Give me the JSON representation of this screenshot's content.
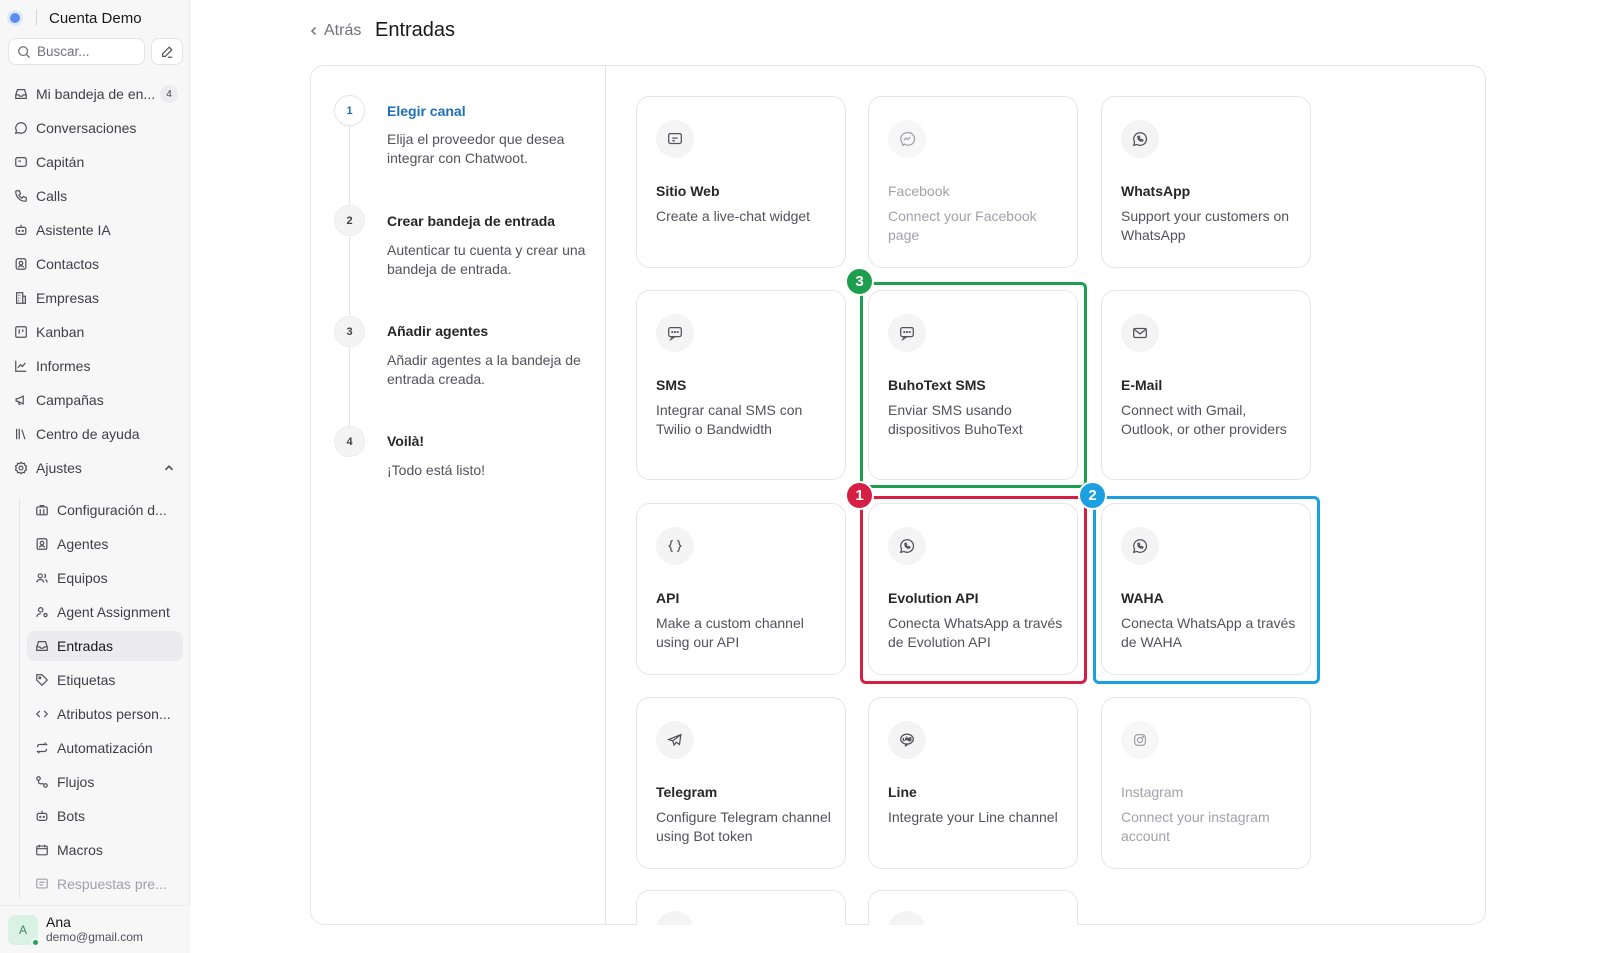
{
  "colors": {
    "accent": "#1d6fb8",
    "highlight_green": "#1e9e4f",
    "highlight_red": "#d61f45",
    "highlight_blue": "#1a9fe0"
  },
  "sidebar": {
    "account_name": "Cuenta Demo",
    "search_placeholder": "Buscar...",
    "items": [
      {
        "label": "Mi bandeja de en...",
        "icon": "inbox-icon",
        "badge": "4"
      },
      {
        "label": "Conversaciones",
        "icon": "chat-bubble-icon"
      },
      {
        "label": "Capitán",
        "icon": "captain-icon"
      },
      {
        "label": "Calls",
        "icon": "phone-icon"
      },
      {
        "label": "Asistente IA",
        "icon": "bot-icon"
      },
      {
        "label": "Contactos",
        "icon": "contact-card-icon"
      },
      {
        "label": "Empresas",
        "icon": "building-icon"
      },
      {
        "label": "Kanban",
        "icon": "kanban-icon"
      },
      {
        "label": "Informes",
        "icon": "chart-line-icon"
      },
      {
        "label": "Campañas",
        "icon": "megaphone-icon"
      },
      {
        "label": "Centro de ayuda",
        "icon": "library-icon"
      },
      {
        "label": "Ajustes",
        "icon": "settings-gear-icon"
      }
    ],
    "settings_items": [
      {
        "label": "Configuración d...",
        "icon": "briefcase-icon"
      },
      {
        "label": "Agentes",
        "icon": "agent-card-icon"
      },
      {
        "label": "Equipos",
        "icon": "users-icon"
      },
      {
        "label": "Agent Assignment",
        "icon": "user-assign-icon"
      },
      {
        "label": "Entradas",
        "icon": "inbox-icon"
      },
      {
        "label": "Etiquetas",
        "icon": "tag-icon"
      },
      {
        "label": "Atributos person...",
        "icon": "code-icon"
      },
      {
        "label": "Automatización",
        "icon": "repeat-icon"
      },
      {
        "label": "Flujos",
        "icon": "flow-icon"
      },
      {
        "label": "Bots",
        "icon": "bot-icon"
      },
      {
        "label": "Macros",
        "icon": "calendar-icon"
      },
      {
        "label": "Respuestas pre...",
        "icon": "canned-response-icon"
      }
    ],
    "user": {
      "initial": "A",
      "name": "Ana",
      "email": "demo@gmail.com"
    }
  },
  "header": {
    "back_label": "Atrás",
    "title": "Entradas"
  },
  "steps": [
    {
      "num": "1",
      "title": "Elegir canal",
      "desc": "Elija el proveedor que desea integrar con Chatwoot."
    },
    {
      "num": "2",
      "title": "Crear bandeja de entrada",
      "desc": "Autenticar tu cuenta y crear una bandeja de entrada."
    },
    {
      "num": "3",
      "title": "Añadir agentes",
      "desc": "Añadir agentes a la bandeja de entrada creada."
    },
    {
      "num": "4",
      "title": "Voilà!",
      "desc": "¡Todo está listo!"
    }
  ],
  "channels": [
    {
      "title": "Sitio Web",
      "desc": "Create a live-chat widget",
      "icon": "website-widget-icon"
    },
    {
      "title": "Facebook",
      "desc": "Connect your Facebook page",
      "icon": "messenger-icon"
    },
    {
      "title": "WhatsApp",
      "desc": "Support your customers on WhatsApp",
      "icon": "whatsapp-icon"
    },
    {
      "title": "SMS",
      "desc": "Integrar canal SMS con Twilio o Bandwidth",
      "icon": "sms-icon"
    },
    {
      "title": "BuhoText SMS",
      "desc": "Enviar SMS usando dispositivos BuhoText",
      "icon": "sms-icon"
    },
    {
      "title": "E-Mail",
      "desc": "Connect with Gmail, Outlook, or other providers",
      "icon": "mail-icon"
    },
    {
      "title": "API",
      "desc": "Make a custom channel using our API",
      "icon": "braces-icon"
    },
    {
      "title": "Evolution API",
      "desc": "Conecta WhatsApp a través de Evolution API",
      "icon": "whatsapp-icon"
    },
    {
      "title": "WAHA",
      "desc": "Conecta WhatsApp a través de WAHA",
      "icon": "whatsapp-icon"
    },
    {
      "title": "Telegram",
      "desc": "Configure Telegram channel using Bot token",
      "icon": "telegram-icon"
    },
    {
      "title": "Line",
      "desc": "Integrate your Line channel",
      "icon": "line-icon"
    },
    {
      "title": "Instagram",
      "desc": "Connect your instagram account",
      "icon": "instagram-icon"
    }
  ],
  "markers": [
    "1",
    "2",
    "3"
  ]
}
